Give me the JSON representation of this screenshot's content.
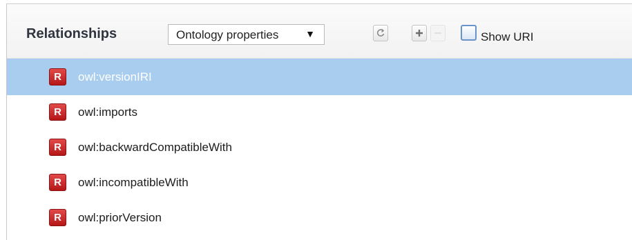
{
  "header": {
    "title": "Relationships",
    "dropdown_value": "Ontology properties",
    "dropdown_arrow": "▼",
    "show_uri_label": "Show URI"
  },
  "toolbar_icons": [
    "refresh-icon",
    "add-icon",
    "remove-icon"
  ],
  "rows": [
    {
      "badge": "R",
      "label": "owl:versionIRI",
      "selected": true
    },
    {
      "badge": "R",
      "label": "owl:imports",
      "selected": false
    },
    {
      "badge": "R",
      "label": "owl:backwardCompatibleWith",
      "selected": false
    },
    {
      "badge": "R",
      "label": "owl:incompatibleWith",
      "selected": false
    },
    {
      "badge": "R",
      "label": "owl:priorVersion",
      "selected": false
    }
  ],
  "colors": {
    "selection": "#a9cdee",
    "badge": "#c92525",
    "checkbox_border": "#6a93c9"
  }
}
